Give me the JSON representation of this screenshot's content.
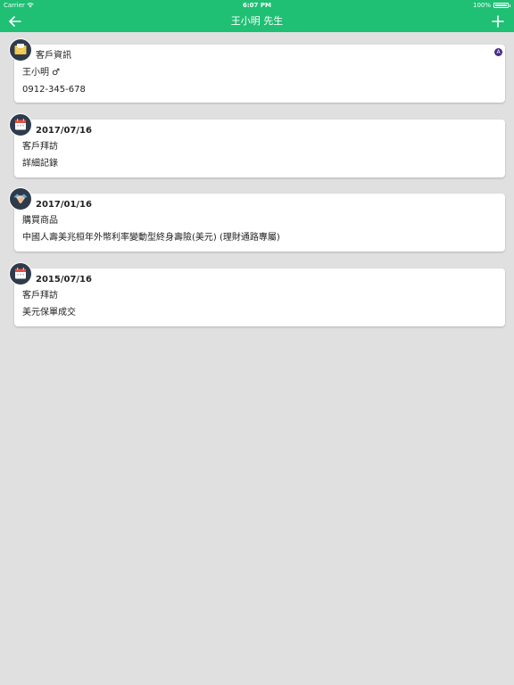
{
  "status_bar": {
    "carrier": "Carrier",
    "time": "6:07 PM",
    "battery": "100%",
    "battery_level": 1.0
  },
  "nav": {
    "title": "王小明 先生"
  },
  "cards": [
    {
      "icon": "envelope-icon",
      "title": "客戶資訊",
      "line1": "王小明 ♂",
      "line2": "0912-345-678",
      "badge": "A"
    },
    {
      "icon": "calendar-icon",
      "title": "2017/07/16",
      "line1": "客戶拜訪",
      "line2": "詳細記錄"
    },
    {
      "icon": "handshake-icon",
      "title": "2017/01/16",
      "line1": "購買商品",
      "line2": "中國人壽美兆桓年外幣利率變動型終身壽險(美元) (理財通路專屬)"
    },
    {
      "icon": "calendar-icon",
      "title": "2015/07/16",
      "line1": "客戶拜訪",
      "line2": "美元保單成交"
    }
  ],
  "colors": {
    "header": "#1fbf74",
    "background": "#e0e0e0",
    "avatar": "#2f3b4b",
    "badge": "#4a2c8a"
  }
}
